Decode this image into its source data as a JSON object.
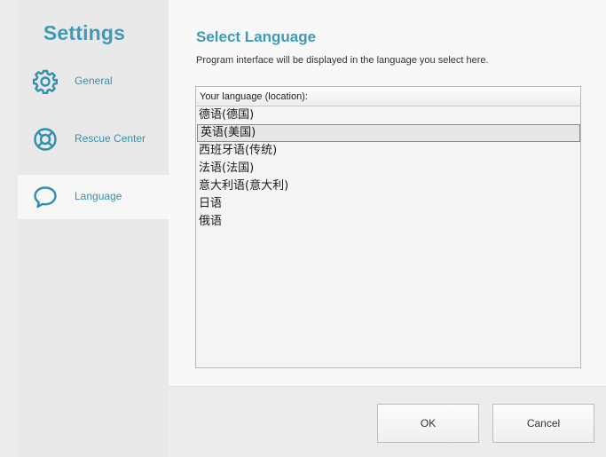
{
  "sidebar": {
    "title": "Settings",
    "items": [
      {
        "label": "General",
        "icon": "gear-icon",
        "active": false
      },
      {
        "label": "Rescue Center",
        "icon": "lifebuoy-icon",
        "active": false
      },
      {
        "label": "Language",
        "icon": "speech-bubble-icon",
        "active": true
      }
    ]
  },
  "main": {
    "title": "Select Language",
    "description": "Program interface will be displayed in the language you select here.",
    "list_header": "Your language (location):",
    "languages": [
      "德语(德国)",
      "英语(美国)",
      "西班牙语(传统)",
      "法语(法国)",
      "意大利语(意大利)",
      "日语",
      "俄语"
    ],
    "selected_language": "英语(美国)"
  },
  "footer": {
    "ok_label": "OK",
    "cancel_label": "Cancel"
  },
  "colors": {
    "accent": "#3d9bb8",
    "sidebar_bg": "#e9e9e9",
    "main_bg": "#f8f8f8"
  }
}
